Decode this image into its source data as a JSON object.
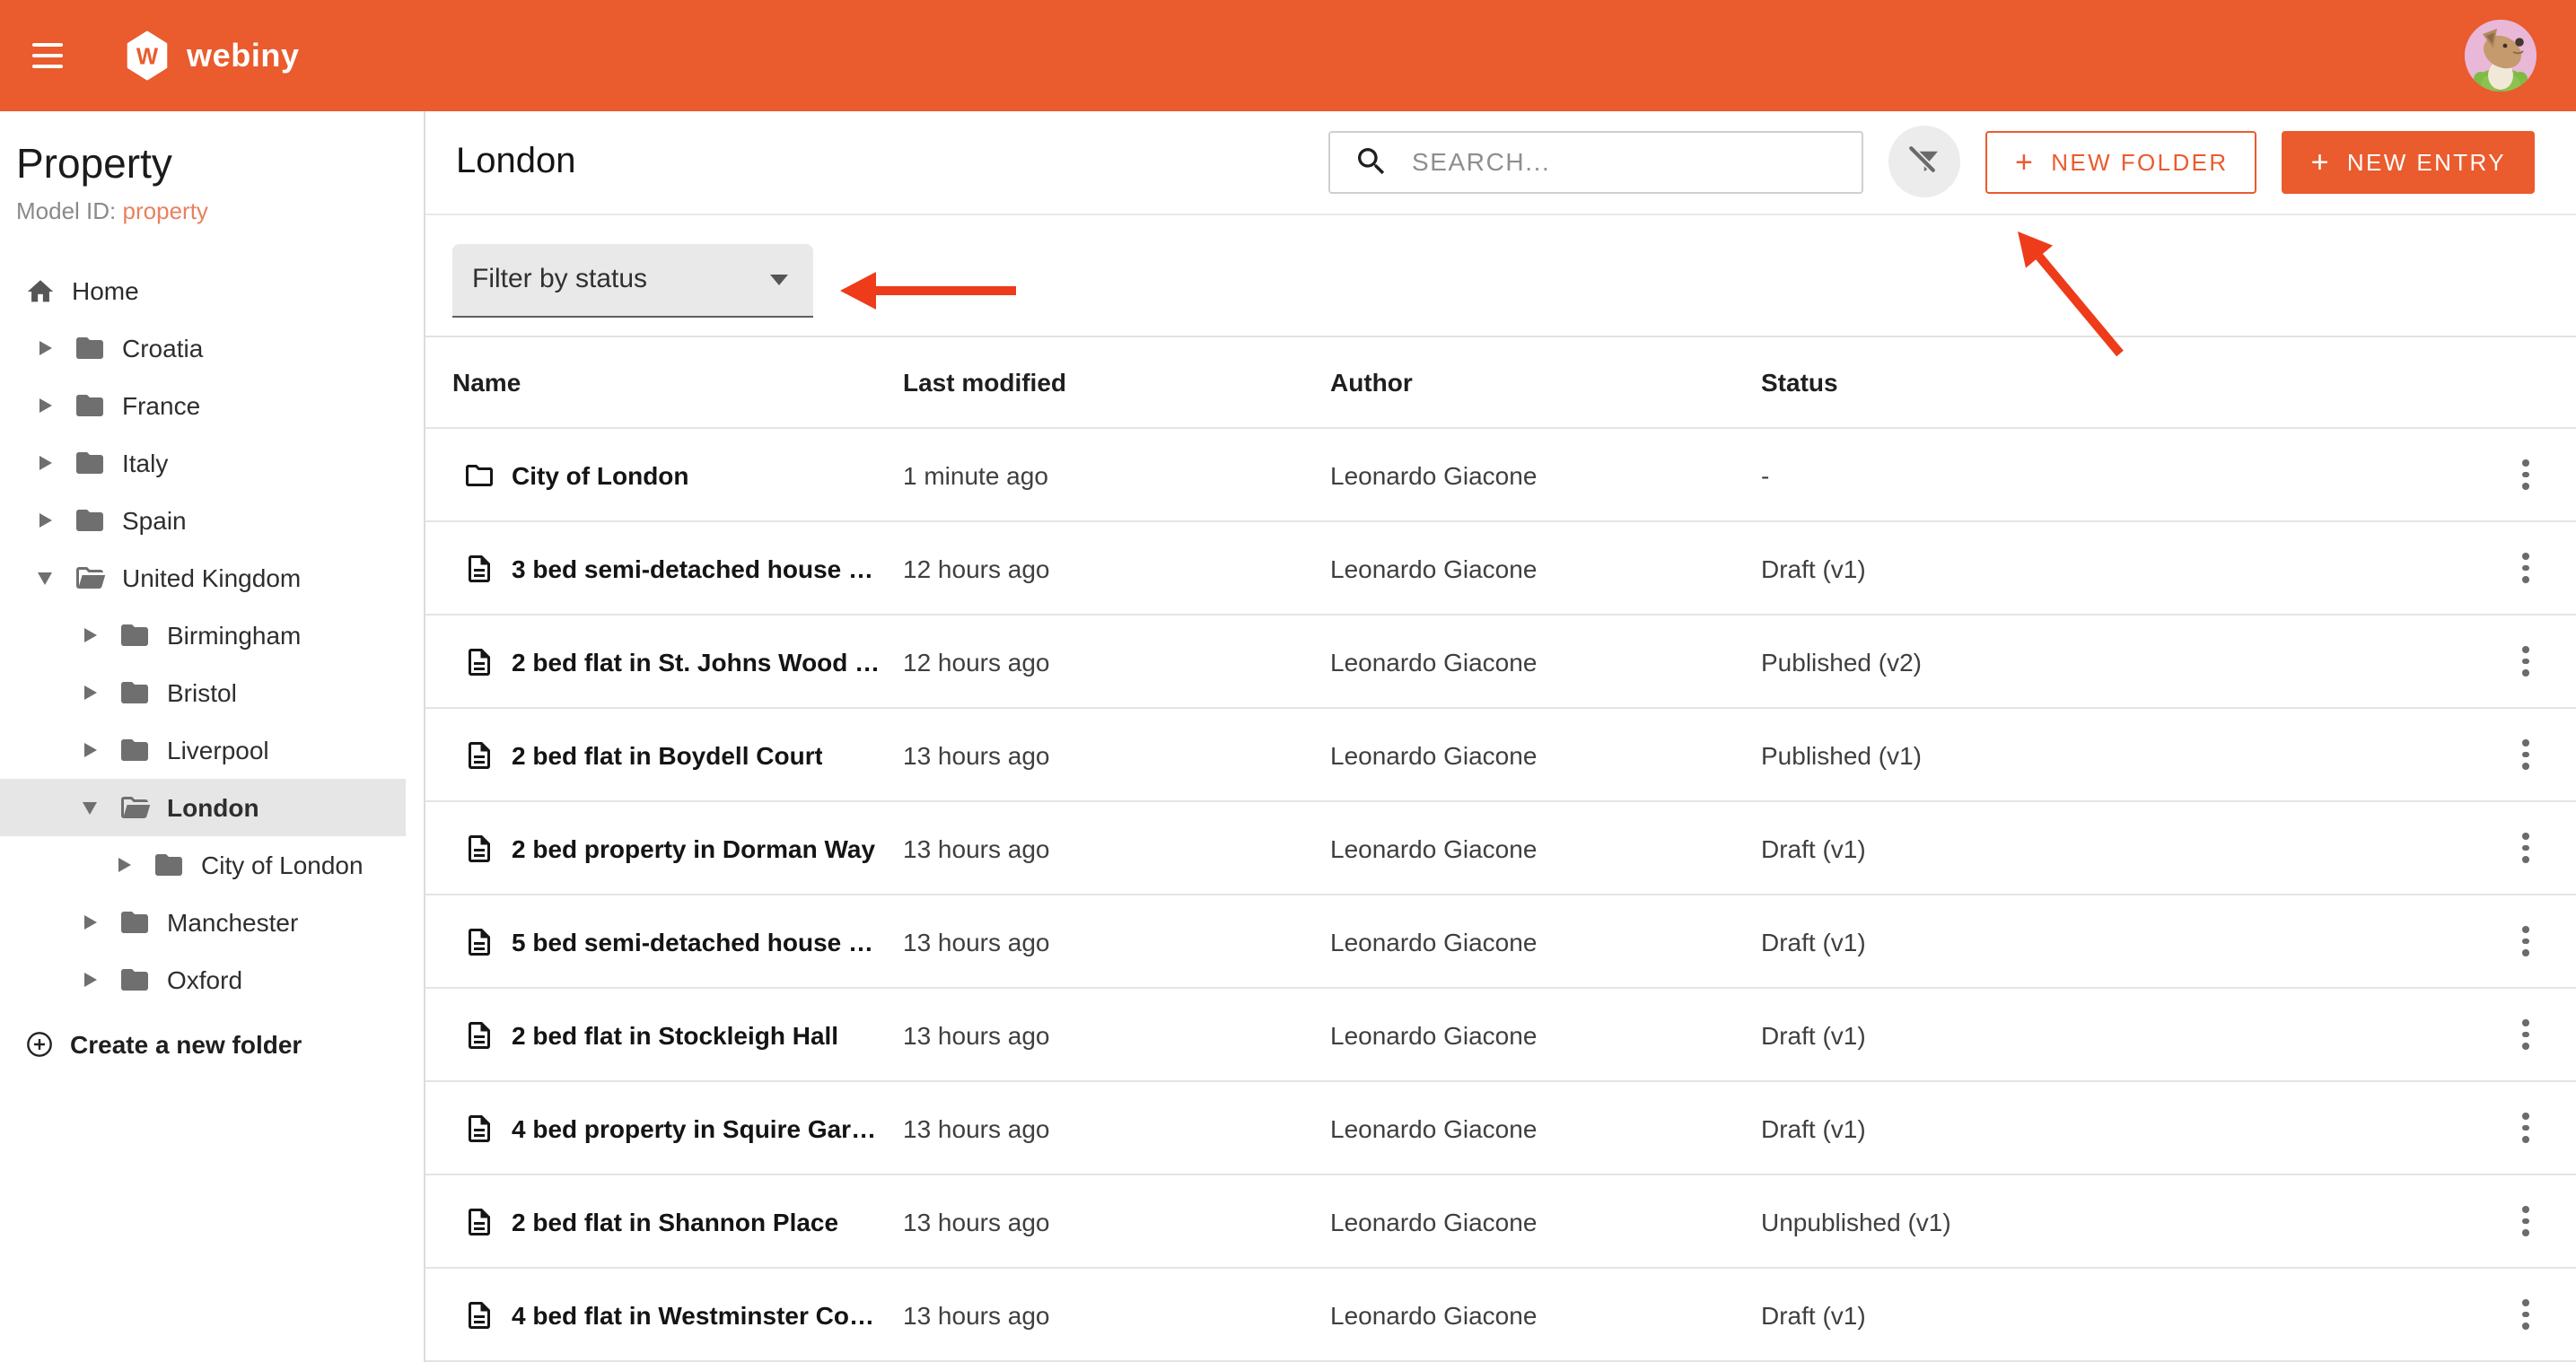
{
  "colors": {
    "brand_orange": "#ea5b2d",
    "annotation_arrow": "#ee3b1a",
    "model_id_link": "#e9805f",
    "selected_folder_bg": "#e6e6e6"
  },
  "topbar": {
    "brand": "webiny",
    "logo_letter": "W"
  },
  "sidebar": {
    "title": "Property",
    "model_id_label": "Model ID:",
    "model_id_value": "property",
    "home_label": "Home",
    "create_folder_label": "Create a new folder",
    "tree": [
      {
        "label": "Croatia",
        "level": 0,
        "expanded": false,
        "selected": false
      },
      {
        "label": "France",
        "level": 0,
        "expanded": false,
        "selected": false
      },
      {
        "label": "Italy",
        "level": 0,
        "expanded": false,
        "selected": false
      },
      {
        "label": "Spain",
        "level": 0,
        "expanded": false,
        "selected": false
      },
      {
        "label": "United Kingdom",
        "level": 0,
        "expanded": true,
        "selected": false
      },
      {
        "label": "Birmingham",
        "level": 1,
        "expanded": false,
        "selected": false
      },
      {
        "label": "Bristol",
        "level": 1,
        "expanded": false,
        "selected": false
      },
      {
        "label": "Liverpool",
        "level": 1,
        "expanded": false,
        "selected": false
      },
      {
        "label": "London",
        "level": 1,
        "expanded": true,
        "selected": true
      },
      {
        "label": "City of London",
        "level": 2,
        "expanded": false,
        "selected": false
      },
      {
        "label": "Manchester",
        "level": 1,
        "expanded": false,
        "selected": false
      },
      {
        "label": "Oxford",
        "level": 1,
        "expanded": false,
        "selected": false
      }
    ]
  },
  "content": {
    "title": "London",
    "search_placeholder": "SEARCH...",
    "plus_glyph": "+",
    "new_folder_label": "NEW FOLDER",
    "new_entry_label": "NEW ENTRY",
    "filter_label": "Filter by status",
    "table": {
      "columns": [
        "Name",
        "Last modified",
        "Author",
        "Status"
      ],
      "rows": [
        {
          "name": "City of London",
          "type": "folder",
          "modified": "1 minute ago",
          "author": "Leonardo Giacone",
          "status": "-"
        },
        {
          "name": "3 bed semi-detached house …",
          "type": "entry",
          "modified": "12 hours ago",
          "author": "Leonardo Giacone",
          "status": "Draft (v1)"
        },
        {
          "name": "2 bed flat in St. Johns Wood …",
          "type": "entry",
          "modified": "12 hours ago",
          "author": "Leonardo Giacone",
          "status": "Published (v2)"
        },
        {
          "name": "2 bed flat in Boydell Court",
          "type": "entry",
          "modified": "13 hours ago",
          "author": "Leonardo Giacone",
          "status": "Published (v1)"
        },
        {
          "name": "2 bed property in Dorman Way",
          "type": "entry",
          "modified": "13 hours ago",
          "author": "Leonardo Giacone",
          "status": "Draft (v1)"
        },
        {
          "name": "5 bed semi-detached house …",
          "type": "entry",
          "modified": "13 hours ago",
          "author": "Leonardo Giacone",
          "status": "Draft (v1)"
        },
        {
          "name": "2 bed flat in Stockleigh Hall",
          "type": "entry",
          "modified": "13 hours ago",
          "author": "Leonardo Giacone",
          "status": "Draft (v1)"
        },
        {
          "name": "4 bed property in Squire Gar…",
          "type": "entry",
          "modified": "13 hours ago",
          "author": "Leonardo Giacone",
          "status": "Draft (v1)"
        },
        {
          "name": "2 bed flat in Shannon Place",
          "type": "entry",
          "modified": "13 hours ago",
          "author": "Leonardo Giacone",
          "status": "Unpublished (v1)"
        },
        {
          "name": "4 bed flat in Westminster Co…",
          "type": "entry",
          "modified": "13 hours ago",
          "author": "Leonardo Giacone",
          "status": "Draft (v1)"
        }
      ]
    }
  }
}
